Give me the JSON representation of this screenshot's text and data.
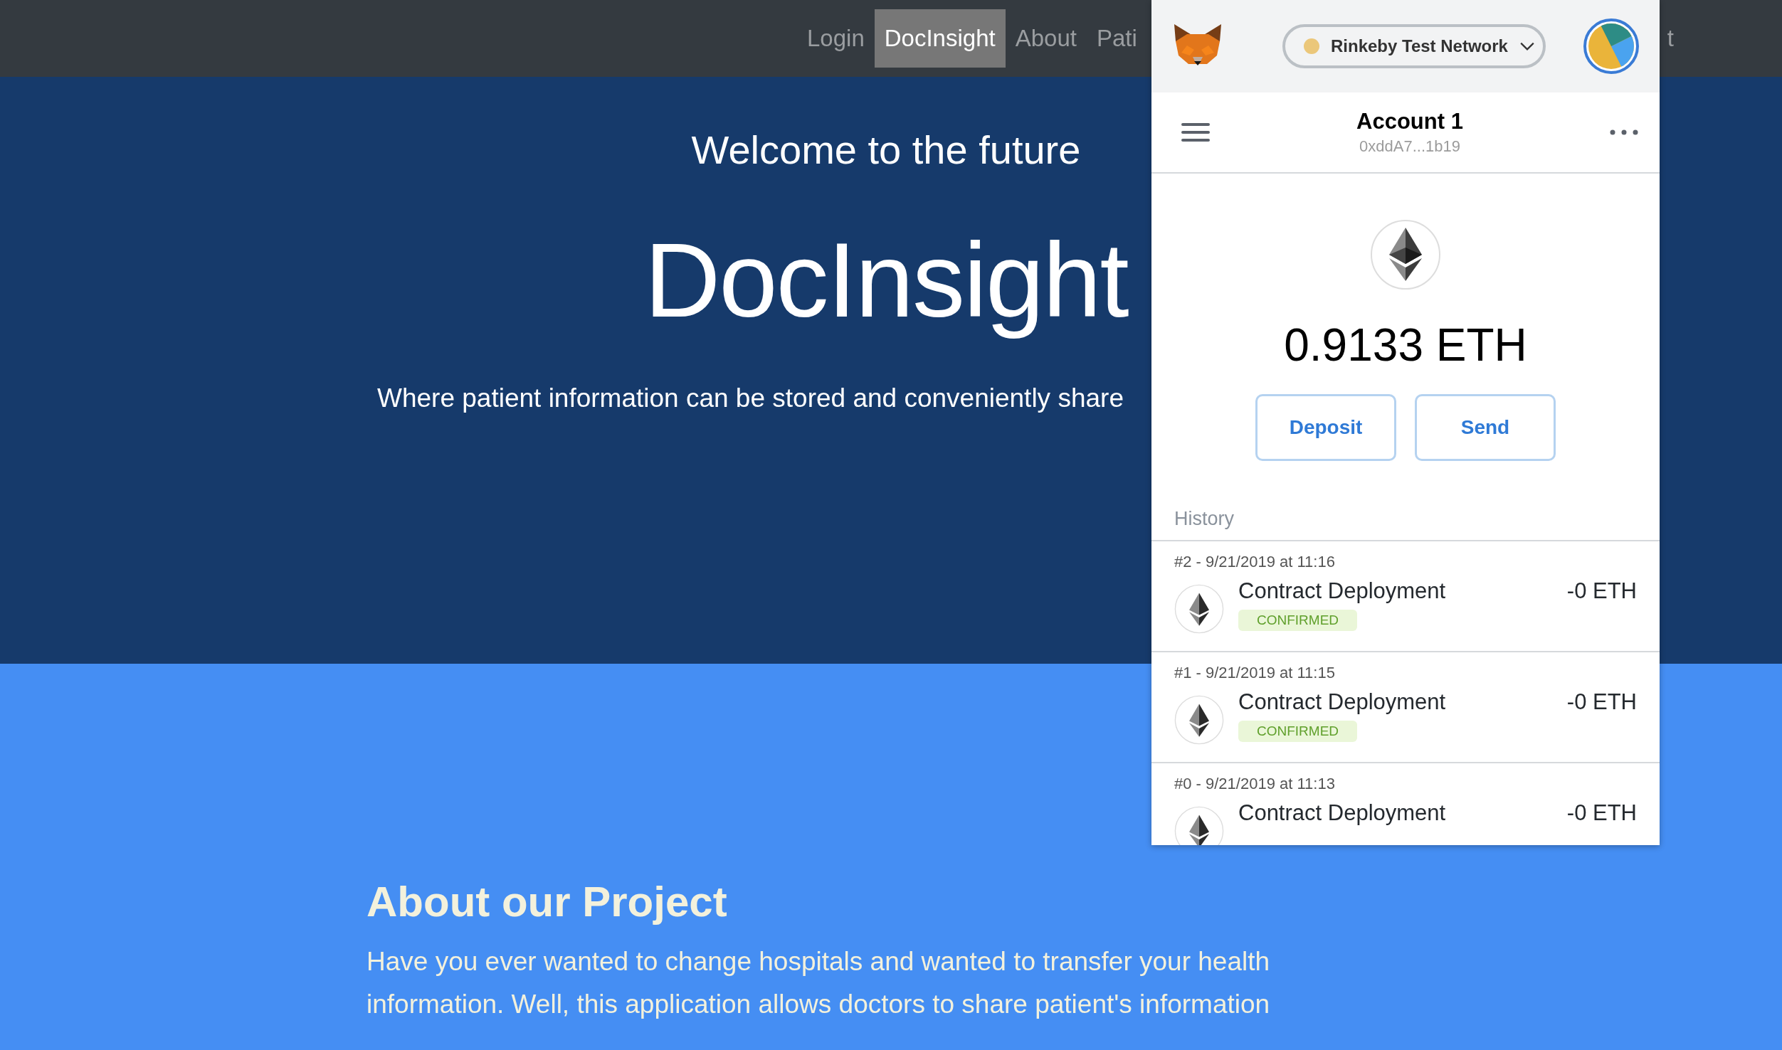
{
  "navbar": {
    "items": [
      {
        "label": "Login",
        "selected": false
      },
      {
        "label": "DocInsight",
        "selected": true
      },
      {
        "label": "About",
        "selected": false
      },
      {
        "label": "Pati",
        "selected": false
      },
      {
        "label": "t",
        "selected": false
      }
    ]
  },
  "hero": {
    "subtitle": "Welcome to the future",
    "title": "DocInsight",
    "tagline": "Where patient information can be stored and conveniently share"
  },
  "about": {
    "heading": "About our Project",
    "text": "Have you ever wanted to change hospitals and wanted to transfer your health information. Well, this application allows doctors to share patient's information"
  },
  "wallet": {
    "network": "Rinkeby Test Network",
    "account": {
      "name": "Account 1",
      "address": "0xddA7...1b19"
    },
    "balance": "0.9133 ETH",
    "buttons": [
      "Deposit",
      "Send"
    ],
    "history_label": "History",
    "transactions": [
      {
        "date": "#2 - 9/21/2019 at 11:16",
        "title": "Contract Deployment",
        "amount": "-0 ETH",
        "status": "CONFIRMED"
      },
      {
        "date": "#1 - 9/21/2019 at 11:15",
        "title": "Contract Deployment",
        "amount": "-0 ETH",
        "status": "CONFIRMED"
      },
      {
        "date": "#0 - 9/21/2019 at 11:13",
        "title": "Contract Deployment",
        "amount": "-0 ETH"
      }
    ]
  }
}
